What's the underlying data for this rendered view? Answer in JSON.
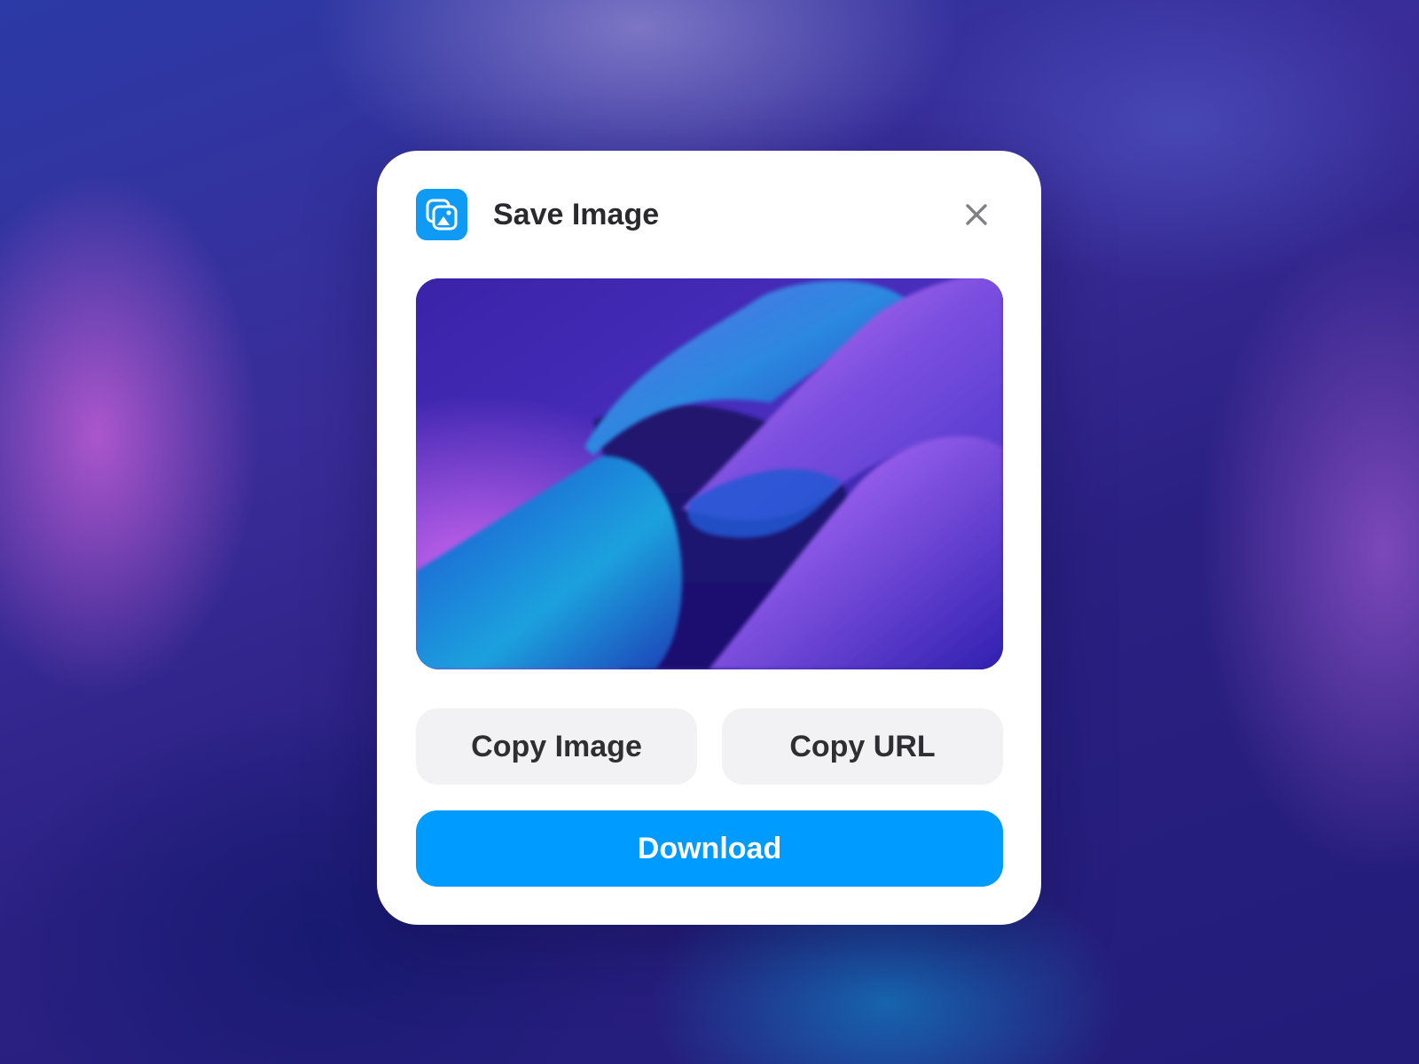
{
  "dialog": {
    "title": "Save Image",
    "icon": "image-copy-icon",
    "close_icon": "close-icon"
  },
  "preview": {
    "description_icon": "image-preview"
  },
  "actions": {
    "copy_image_label": "Copy Image",
    "copy_url_label": "Copy URL",
    "download_label": "Download"
  },
  "colors": {
    "accent": "#009bff",
    "icon_bg": "#0f9bf5",
    "secondary_button_bg": "#f2f2f4",
    "dialog_bg": "#ffffff"
  }
}
